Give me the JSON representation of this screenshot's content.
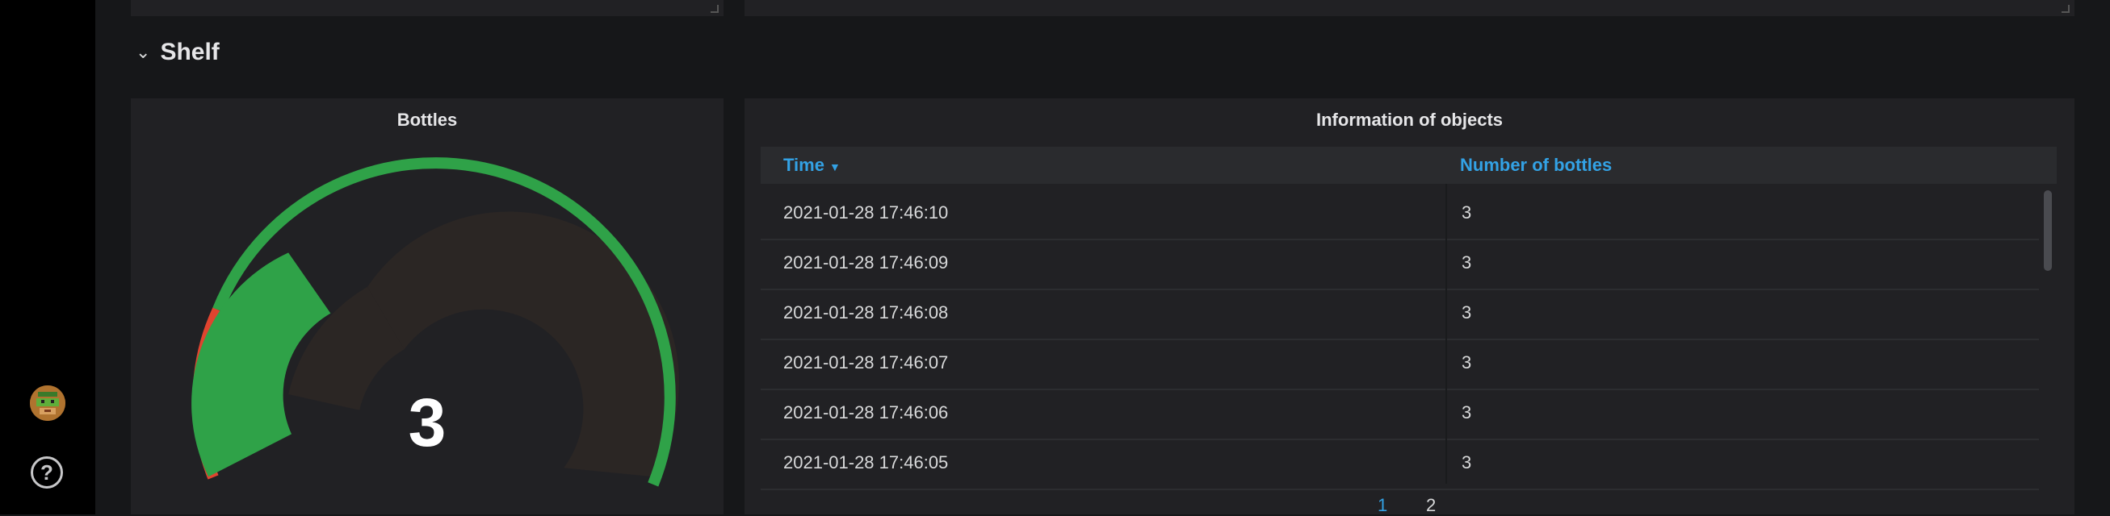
{
  "row": {
    "title": "Shelf"
  },
  "gauge_panel": {
    "title": "Bottles",
    "value": "3",
    "colors": {
      "ok": "#2fa248",
      "threshold_low": "#e0442f",
      "track": "#2b2624"
    }
  },
  "table_panel": {
    "title": "Information of objects",
    "columns": [
      "Time",
      "Number of bottles"
    ],
    "sort_column": "Time",
    "sort_direction": "descending",
    "rows": [
      {
        "time": "2021-01-28 17:46:10",
        "count": "3"
      },
      {
        "time": "2021-01-28 17:46:09",
        "count": "3"
      },
      {
        "time": "2021-01-28 17:46:08",
        "count": "3"
      },
      {
        "time": "2021-01-28 17:46:07",
        "count": "3"
      },
      {
        "time": "2021-01-28 17:46:06",
        "count": "3"
      },
      {
        "time": "2021-01-28 17:46:05",
        "count": "3"
      }
    ],
    "pages": [
      "1",
      "2"
    ],
    "current_page": "1",
    "colors": {
      "header_link": "#33a2e5",
      "active_page": "#33a2e5"
    }
  },
  "sidebar": {
    "avatar_icon": "user-avatar-icon",
    "help_icon": "question-circle-icon",
    "help_glyph": "?"
  },
  "icons": {
    "row_toggle": "chevron-down-icon",
    "sort": "sort-desc-icon"
  }
}
